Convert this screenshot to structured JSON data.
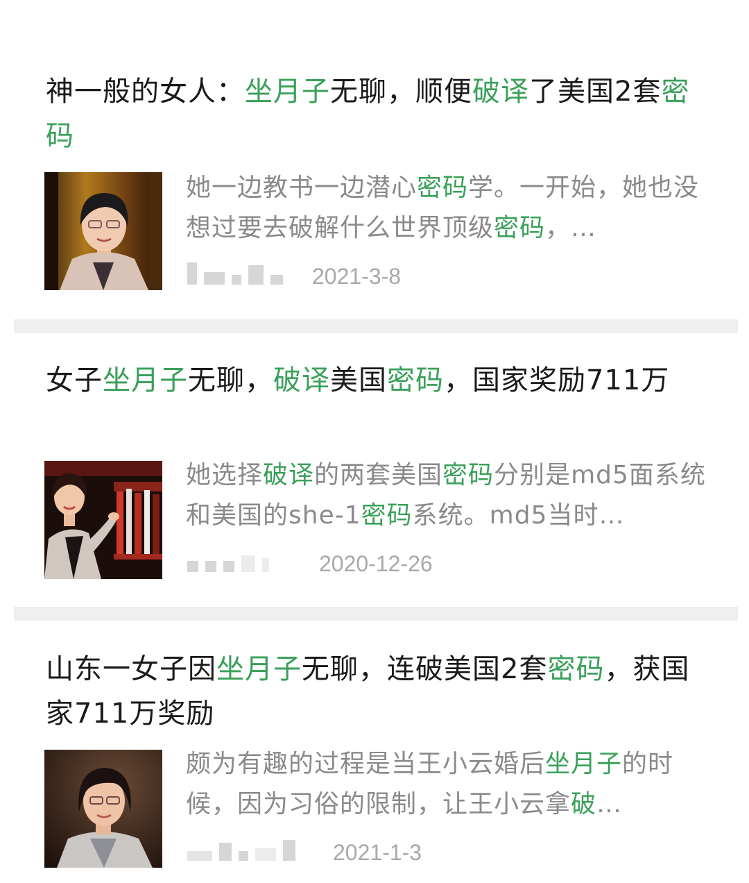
{
  "colors": {
    "highlight": "#3aa05a",
    "title": "#1a1a1a",
    "snippet": "#8a8a8a",
    "date": "#a8a8a8",
    "divider": "#efefef"
  },
  "articles": [
    {
      "title_parts": [
        {
          "t": "神一般的女人：",
          "hl": false
        },
        {
          "t": "坐月子",
          "hl": true
        },
        {
          "t": "无聊，顺便",
          "hl": false
        },
        {
          "t": "破译",
          "hl": true
        },
        {
          "t": "了美国2套",
          "hl": false
        },
        {
          "t": "密码",
          "hl": true
        }
      ],
      "snippet_parts": [
        {
          "t": "她一边教书一边潜心",
          "hl": false
        },
        {
          "t": "密码",
          "hl": true
        },
        {
          "t": "学。一开始，她也没想过要去破解什么世界顶级",
          "hl": false
        },
        {
          "t": "密码",
          "hl": true
        },
        {
          "t": "，…",
          "hl": false
        }
      ],
      "date": "2021-3-8",
      "thumb_icon": "woman-portrait-image"
    },
    {
      "title_parts": [
        {
          "t": "女子",
          "hl": false
        },
        {
          "t": "坐月子",
          "hl": true
        },
        {
          "t": "无聊，",
          "hl": false
        },
        {
          "t": "破译",
          "hl": true
        },
        {
          "t": "美国",
          "hl": false
        },
        {
          "t": "密码",
          "hl": true
        },
        {
          "t": "，国家奖励711万",
          "hl": false
        }
      ],
      "snippet_parts": [
        {
          "t": "她选择",
          "hl": false
        },
        {
          "t": "破译",
          "hl": true
        },
        {
          "t": "的两套美国",
          "hl": false
        },
        {
          "t": "密码",
          "hl": true
        },
        {
          "t": "分别是md5面系统和美国的she-1",
          "hl": false
        },
        {
          "t": "密码",
          "hl": true
        },
        {
          "t": "系统。md5当时…",
          "hl": false
        }
      ],
      "date": "2020-12-26",
      "thumb_icon": "woman-speaking-image"
    },
    {
      "title_parts": [
        {
          "t": "山东一女子因",
          "hl": false
        },
        {
          "t": "坐月子",
          "hl": true
        },
        {
          "t": "无聊，连破美国2套",
          "hl": false
        },
        {
          "t": "密码",
          "hl": true
        },
        {
          "t": "，获国家711万奖励",
          "hl": false
        }
      ],
      "snippet_parts": [
        {
          "t": "颇为有趣的过程是当王小云婚后",
          "hl": false
        },
        {
          "t": "坐月子",
          "hl": true
        },
        {
          "t": "的时候，因为习俗的限制，让王小云拿",
          "hl": false
        },
        {
          "t": "破",
          "hl": true
        },
        {
          "t": "…",
          "hl": false
        }
      ],
      "date": "2021-1-3",
      "thumb_icon": "woman-interview-image"
    }
  ]
}
